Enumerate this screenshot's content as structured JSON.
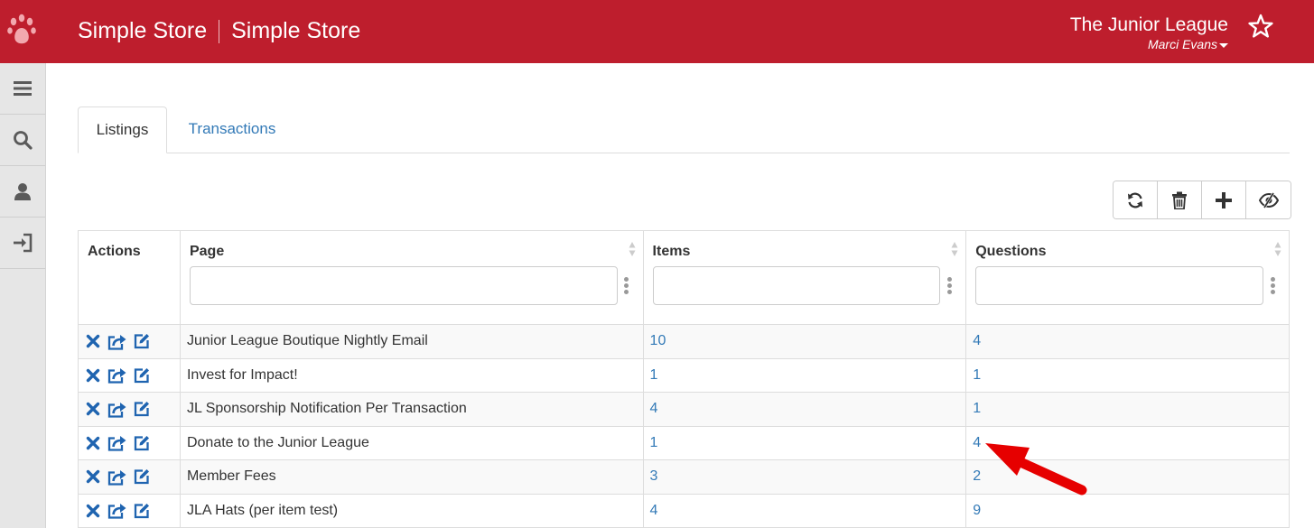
{
  "header": {
    "brand_left": "Simple Store",
    "brand_right": "Simple Store",
    "org_name": "The Junior League",
    "user_name": "Marci Evans",
    "bg_color": "#be1e2d"
  },
  "sidebar": {
    "items": [
      {
        "icon": "menu-icon"
      },
      {
        "icon": "search-icon"
      },
      {
        "icon": "user-icon"
      },
      {
        "icon": "sign-in-icon"
      }
    ]
  },
  "tabs": [
    {
      "label": "Listings",
      "active": true
    },
    {
      "label": "Transactions",
      "active": false
    }
  ],
  "toolbar": {
    "buttons": [
      "refresh-icon",
      "trash-icon",
      "plus-icon",
      "hide-columns-icon"
    ]
  },
  "table": {
    "columns": [
      "Actions",
      "Page",
      "Items",
      "Questions"
    ],
    "rows": [
      {
        "page": "Junior League Boutique Nightly Email",
        "items": "10",
        "questions": "4"
      },
      {
        "page": "Invest for Impact!",
        "items": "1",
        "questions": "1"
      },
      {
        "page": "JL Sponsorship Notification Per Transaction",
        "items": "4",
        "questions": "1"
      },
      {
        "page": "Donate to the Junior League",
        "items": "1",
        "questions": "4"
      },
      {
        "page": "Member Fees",
        "items": "3",
        "questions": "2"
      },
      {
        "page": "JLA Hats (per item test)",
        "items": "4",
        "questions": "9"
      }
    ]
  },
  "colors": {
    "link": "#337ab7",
    "action_icon": "#1f64b0",
    "annotation_arrow": "#e60000"
  }
}
